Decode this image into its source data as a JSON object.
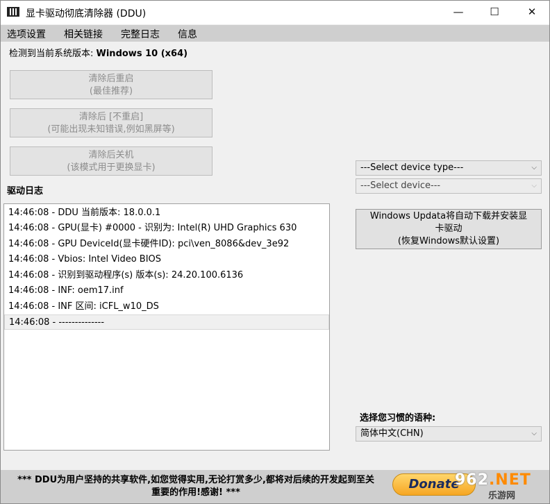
{
  "window": {
    "title": "显卡驱动彻底清除器 (DDU)",
    "icon": "ddu-grid-icon",
    "controls": {
      "minimize": "—",
      "maximize": "☐",
      "close": "✕"
    }
  },
  "menu": [
    "选项设置",
    "相关链接",
    "完整日志",
    "信息"
  ],
  "detect": {
    "label": "检测到当前系统版本: ",
    "value": "Windows 10 (x64)"
  },
  "buttons": {
    "clean_restart": {
      "line1": "清除后重启",
      "line2": "(最佳推荐)"
    },
    "clean_no_restart": {
      "line1": "清除后 [不重启]",
      "line2": "(可能出现未知错误,例如黑屏等)"
    },
    "clean_shutdown": {
      "line1": "清除后关机",
      "line2": "(该模式用于更换显卡)"
    },
    "windows_update": {
      "line1": "Windows Updata将自动下载并安装显",
      "line2": "卡驱动",
      "line3": "(恢复Windows默认设置)"
    }
  },
  "device_type": {
    "selected": "---Select device type---"
  },
  "device": {
    "selected": "---Select device---"
  },
  "log": {
    "label": "驱动日志",
    "entries": [
      "14:46:08 - DDU 当前版本: 18.0.0.1",
      "14:46:08 - GPU(显卡) #0000 - 识别为: Intel(R) UHD Graphics 630",
      "14:46:08 - GPU DeviceId(显卡硬件ID): pci\\ven_8086&dev_3e92",
      "14:46:08 - Vbios: Intel Video BIOS",
      "14:46:08 - 识别到驱动程序(s) 版本(s): 24.20.100.6136",
      "14:46:08 - INF: oem17.inf",
      "14:46:08 - INF 区间: iCFL_w10_DS",
      "14:46:08 - --------------"
    ]
  },
  "language": {
    "label": "选择您习惯的语种:",
    "selected": "简体中文(CHN)"
  },
  "footer": {
    "line1": "*** DDU为用户坚持的共享软件,如您觉得实用,无论打赏多少,都将对后续的开发起到至关",
    "line2": "重要的作用!感谢! ***",
    "donate": "Donate"
  },
  "watermark": {
    "top_a": "962",
    "top_b": ".NET",
    "bottom": "乐游网"
  }
}
